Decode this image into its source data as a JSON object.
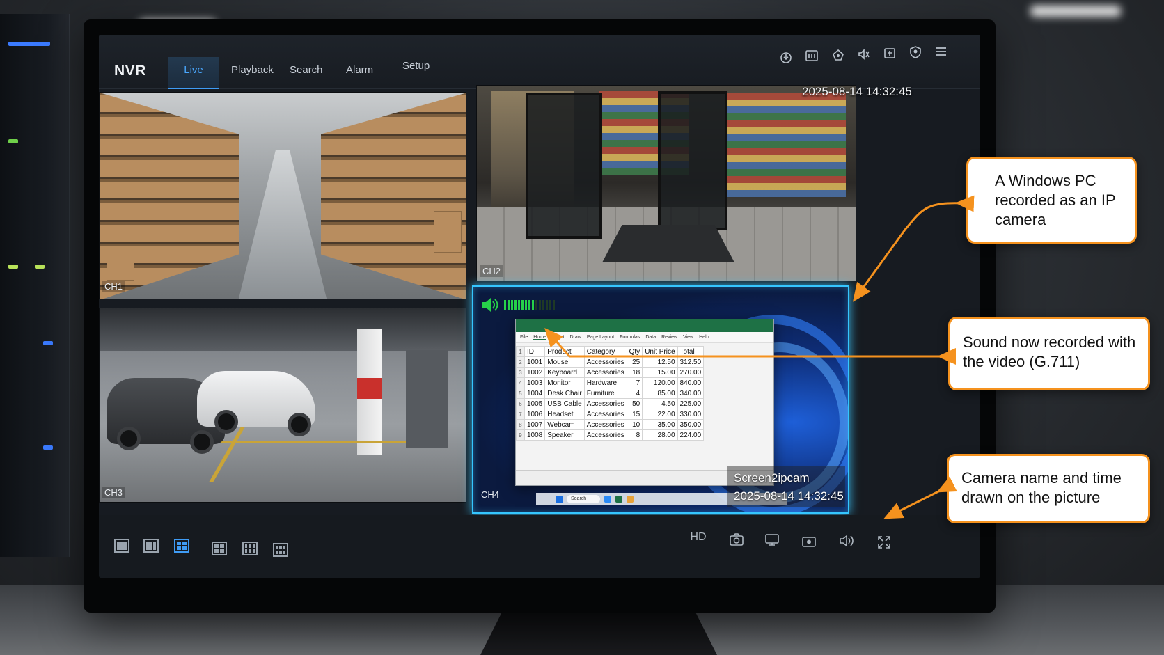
{
  "app": {
    "brand": "NVR"
  },
  "nav": {
    "tabs": [
      {
        "label": "Live",
        "active": true
      },
      {
        "label": "Playback",
        "active": false
      },
      {
        "label": "Search",
        "active": false
      },
      {
        "label": "Alarm",
        "active": false
      },
      {
        "label": "Setup",
        "active": false
      }
    ],
    "icons": [
      "download-icon",
      "film-icon",
      "alarm-bell-icon",
      "audio-icon",
      "export-icon",
      "shield-icon",
      "menu-icon"
    ]
  },
  "header": {
    "datetime": "2025-08-14 14:32:45"
  },
  "channels": {
    "ch1": {
      "label": "CH1"
    },
    "ch2": {
      "label": "CH2"
    },
    "ch3": {
      "label": "CH3"
    },
    "ch4": {
      "label": "CH4",
      "overlay_name": "Screen2ipcam",
      "overlay_time": "2025-08-14 14:32:45",
      "audio_level": 0.6
    }
  },
  "spreadsheet": {
    "ribbon": [
      "File",
      "Home",
      "Insert",
      "Draw",
      "Page Layout",
      "Formulas",
      "Data",
      "Review",
      "View",
      "Help"
    ],
    "headers": [
      "ID",
      "Product",
      "Category",
      "Qty",
      "Unit Price",
      "Total"
    ],
    "rows": [
      [
        "1001",
        "Mouse",
        "Accessories",
        "25",
        "12.50",
        "312.50"
      ],
      [
        "1002",
        "Keyboard",
        "Accessories",
        "18",
        "15.00",
        "270.00"
      ],
      [
        "1003",
        "Monitor",
        "Hardware",
        "7",
        "120.00",
        "840.00"
      ],
      [
        "1004",
        "Desk Chair",
        "Furniture",
        "4",
        "85.00",
        "340.00"
      ],
      [
        "1005",
        "USB Cable",
        "Accessories",
        "50",
        "4.50",
        "225.00"
      ],
      [
        "1006",
        "Headset",
        "Accessories",
        "15",
        "22.00",
        "330.00"
      ],
      [
        "1007",
        "Webcam",
        "Accessories",
        "10",
        "35.00",
        "350.00"
      ],
      [
        "1008",
        "Speaker",
        "Accessories",
        "8",
        "28.00",
        "224.00"
      ]
    ],
    "taskbar_search": "Search"
  },
  "bottom": {
    "layouts": [
      "layout-1x1-icon",
      "layout-1plus2-icon",
      "layout-2x2-icon",
      "layout-1plus3-icon",
      "layout-3x3-icon",
      "layout-4x4-icon"
    ],
    "active_layout": "layout-2x2-icon",
    "quality": "HD",
    "controls": [
      "snapshot-icon",
      "screen-icon",
      "record-icon",
      "volume-icon",
      "fullscreen-icon"
    ]
  },
  "callouts": {
    "pc": "A Windows PC recorded as an IP camera",
    "sound": "Sound now recorded with the video (G.711)",
    "overlay": "Camera name and time drawn on the picture"
  },
  "colors": {
    "accent": "#3f9cf5",
    "callout_border": "#f5921e",
    "ch4_glow": "#35c6ff",
    "audio_green": "#27d14a"
  }
}
